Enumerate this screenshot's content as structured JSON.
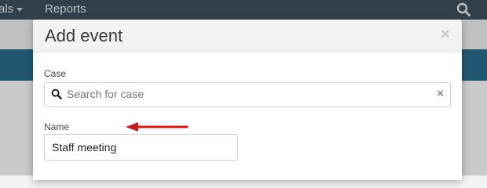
{
  "nav": {
    "partial_item": "als",
    "reports": "Reports",
    "search_icon": "search-icon"
  },
  "modal": {
    "title": "Add event",
    "close_glyph": "×",
    "case": {
      "label": "Case",
      "placeholder": "Search for case",
      "clear_glyph": "×"
    },
    "name": {
      "label": "Name",
      "value": "Staff meeting"
    }
  },
  "colors": {
    "nav_bg": "#3d4f5c",
    "accent_band": "#2a6b8a",
    "annotation_arrow": "#c41c1c"
  }
}
